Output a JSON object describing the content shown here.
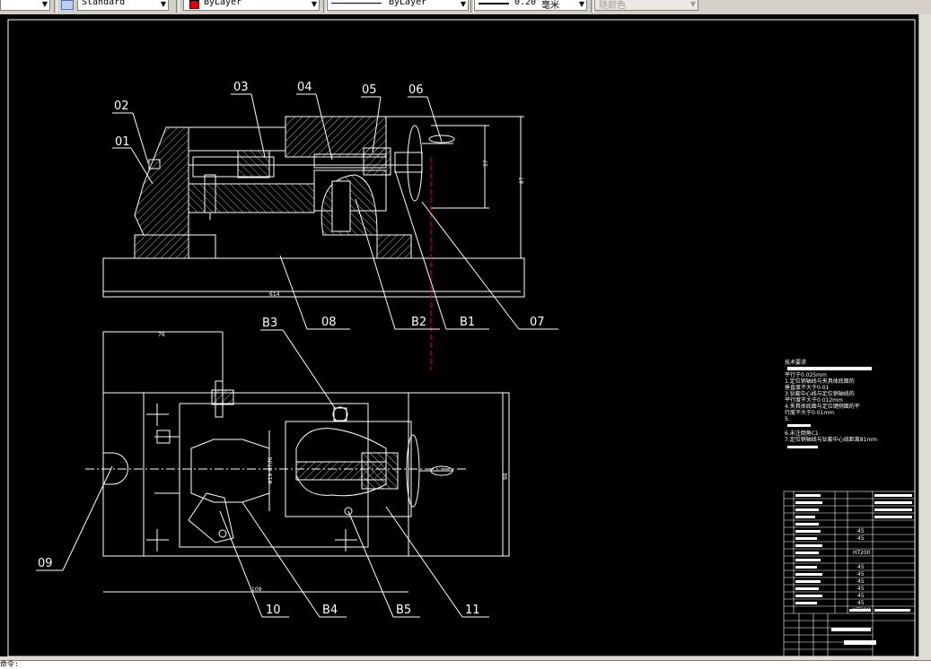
{
  "toolbar": {
    "textstyle_icon": "text-style-icon",
    "textstyle": "Standard",
    "color": "ByLayer",
    "color_swatch": "#e00000",
    "linetype": "ByLayer",
    "lineweight": "0.20",
    "lineweight_unit": "毫米",
    "plotstyle": "随颜色"
  },
  "drawing": {
    "front_labels": [
      "02",
      "01",
      "03",
      "04",
      "05",
      "06"
    ],
    "lower_labels": [
      "08",
      "B2",
      "B1",
      "07"
    ],
    "plan_labels": [
      "B3",
      "09",
      "10",
      "B4",
      "B5",
      "11"
    ],
    "dims": {
      "overall_front": "614",
      "height_a": "57",
      "height_b": "87",
      "plan_top": "76",
      "plan_bottom": "109",
      "plan_right": "98",
      "plan_mid": "Φ19 H7/f6"
    },
    "notes_title": "技术要求",
    "notes": [
      "平行于0.025mm",
      "1.定位销轴线与夹具体底面的",
      "垂直度不大于0.01",
      "3.钻套中心线与定位销轴线的",
      "平行度不大于0.012mm",
      "4.夹具体底面与定位键侧面的平",
      "行度不大于0.01mm",
      "5.",
      "6.未注倒角C1",
      "7.定位销轴线与钻套中心线距离81mm"
    ],
    "bom_materials": [
      "45",
      "45",
      "HT200",
      "45",
      "45",
      "45",
      "45",
      "45",
      "45",
      "HT200"
    ]
  },
  "cmdline": {
    "text": "命令:"
  },
  "colors": {
    "canvas": "#000000",
    "lines": "#ffffff",
    "centerline": "#ff0000"
  }
}
